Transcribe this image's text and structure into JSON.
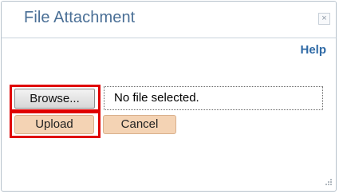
{
  "dialog": {
    "title": "File Attachment",
    "close_icon": "close-icon",
    "help_label": "Help"
  },
  "attachment": {
    "browse_label": "Browse...",
    "file_status": "No file selected.",
    "upload_label": "Upload",
    "cancel_label": "Cancel"
  },
  "colors": {
    "title_text": "#4a6f96",
    "help_link": "#2f6aa6",
    "highlight_border": "#e00000",
    "action_button_fill": "#f4d3b4"
  },
  "icons": {
    "close": "close-icon",
    "resize": "resize-grip-icon"
  }
}
